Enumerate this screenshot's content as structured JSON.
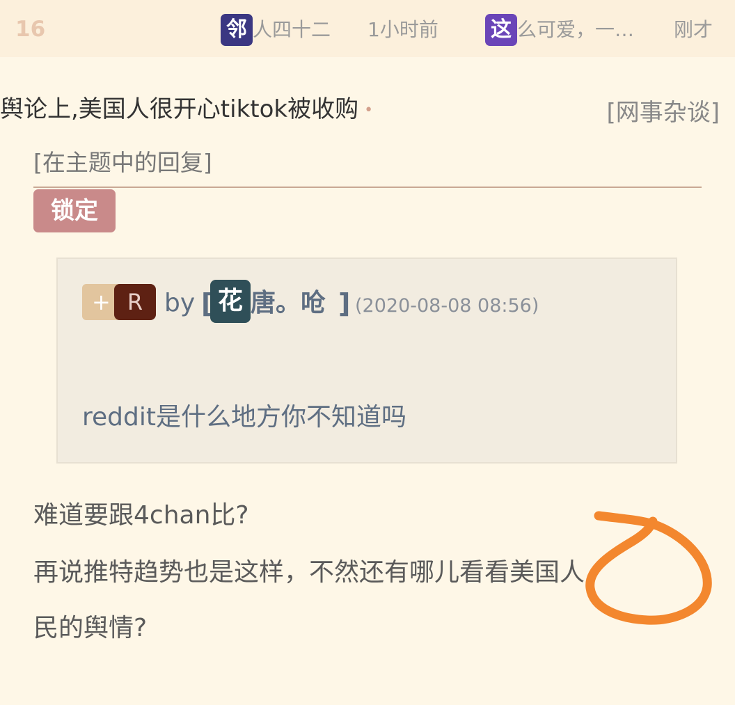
{
  "header": {
    "floor": "16",
    "latest": [
      {
        "avatar": "邻",
        "avatar_color": "#3b3782",
        "text": "人四十二",
        "time": "1小时前"
      },
      {
        "avatar": "这",
        "avatar_color": "#6a45b8",
        "text": "么可爱，一…",
        "time": "刚才"
      }
    ]
  },
  "thread": {
    "title": "舆论上,美国人很开心tiktok被收购",
    "dot": "•",
    "forum": "[网事杂谈]",
    "reply_in": "[在主题中的回复]",
    "lock_label": "锁定"
  },
  "quote": {
    "plus": "+",
    "badge": "R",
    "by": "by",
    "bracket_open": "[",
    "user_first_char": "花",
    "user_rest": "唐。呛",
    "bracket_close": "]",
    "timestamp": "(2020-08-08 08:56)",
    "text": "reddit是什么地方你不知道吗"
  },
  "reply": {
    "lines": [
      "难道要跟4chan比?",
      "再说推特趋势也是这样，不然还有哪儿看看美国人",
      "民的舆情?"
    ]
  },
  "colors": {
    "background": "#fef7e7",
    "topbar": "#fcf0dc",
    "lock_badge": "#c98a8a",
    "annotation": "#f27a1a"
  }
}
